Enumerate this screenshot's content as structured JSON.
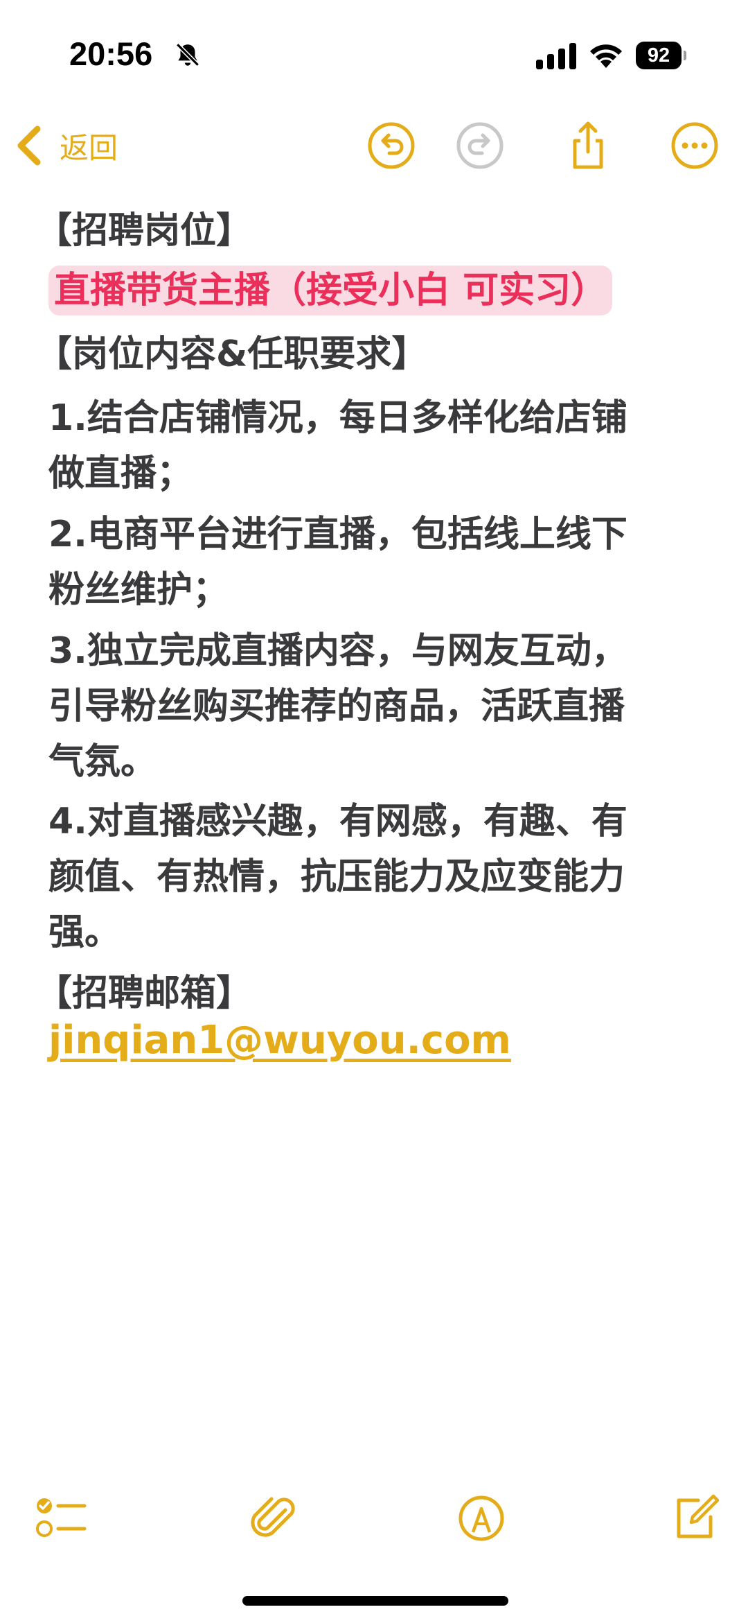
{
  "status_bar": {
    "time": "20:56",
    "battery": "92"
  },
  "toolbar": {
    "back_label": "返回"
  },
  "note": {
    "lines": [
      "【招聘岗位】",
      "直播带货主播（接受小白 可实习）",
      "【岗位内容&任职要求】",
      "1.结合店铺情况，每日多样化给店铺",
      "做直播；",
      "2.电商平台进行直播，包括线上线下",
      "粉丝维护；",
      "3.独立完成直播内容，与网友互动，",
      "引导粉丝购买推荐的商品，活跃直播",
      "气氛。",
      "4.对直播感兴趣，有网感，有趣、有",
      "颜值、有热情，抗压能力及应变能力",
      "强。",
      "【招聘邮箱】"
    ],
    "email": "jinqian1@wuyou.com"
  },
  "colors": {
    "accent": "#e3ac18",
    "highlight_bg": "#fbdbe3",
    "highlight_text": "#ea2f5a",
    "body_text": "#3a3a3c"
  },
  "icons": {
    "status": [
      "bell-slash-icon",
      "signal-icon",
      "wifi-icon",
      "battery-icon"
    ],
    "toolbar": [
      "chevron-left-icon",
      "undo-icon",
      "redo-icon",
      "share-icon",
      "more-icon"
    ],
    "bottom": [
      "checklist-icon",
      "paperclip-icon",
      "markup-icon",
      "compose-icon"
    ]
  }
}
